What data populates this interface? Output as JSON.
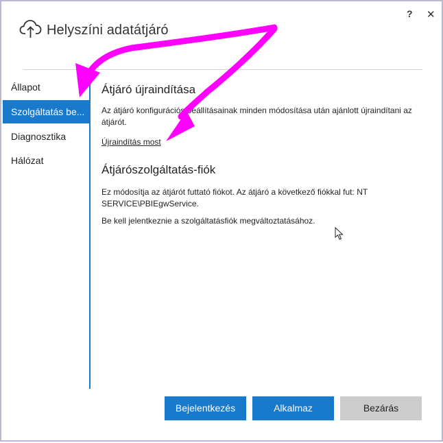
{
  "window": {
    "title": "Helyszíni adatátjáró",
    "help_label": "?",
    "close_label": "✕"
  },
  "sidebar": {
    "items": [
      {
        "label": "Állapot"
      },
      {
        "label": "Szolgáltatás be..."
      },
      {
        "label": "Diagnosztika"
      },
      {
        "label": "Hálózat"
      }
    ],
    "active_index": 1
  },
  "main": {
    "restart": {
      "title": "Átjáró újraindítása",
      "description": "Az átjáró konfigurációs beállításainak minden módosítása után ajánlott újraindítani az átjárót.",
      "link": "Újraindítás most"
    },
    "service_account": {
      "title": "Átjárószolgáltatás-fiók",
      "description": "Ez módosítja az átjárót futtató fiókot. Az átjáró a következő fiókkal fut: NT SERVICE\\PBIEgwService.",
      "note": "Be kell jelentkeznie a szolgáltatásfiók megváltoztatásához."
    }
  },
  "footer": {
    "signin_label": "Bejelentkezés",
    "apply_label": "Alkalmaz",
    "close_label": "Bezárás"
  },
  "colors": {
    "accent": "#1979ca",
    "annotation_arrow": "#ff00ff",
    "secondary_button": "#cccccc"
  },
  "icons": {
    "app_icon": "cloud-upload-icon",
    "cursor": "mouse-pointer-icon"
  }
}
